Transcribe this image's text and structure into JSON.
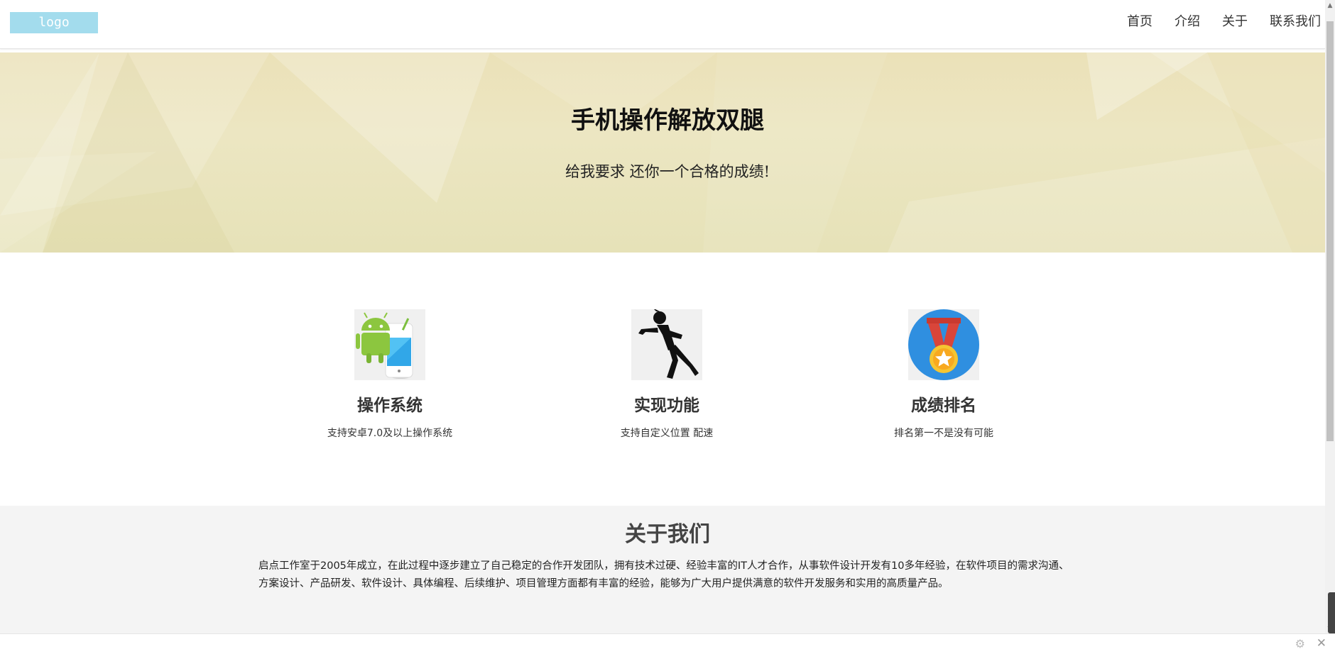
{
  "header": {
    "logo_text": "logo",
    "nav": [
      "首页",
      "介绍",
      "关于",
      "联系我们"
    ]
  },
  "hero": {
    "title": "手机操作解放双腿",
    "subtitle": "给我要求 还你一个合格的成绩!"
  },
  "features": [
    {
      "icon": "android-phone-icon",
      "title": "操作系统",
      "desc": "支持安卓7.0及以上操作系统"
    },
    {
      "icon": "running-man-icon",
      "title": "实现功能",
      "desc": "支持自定义位置 配速"
    },
    {
      "icon": "medal-icon",
      "title": "成绩排名",
      "desc": "排名第一不是没有可能"
    }
  ],
  "about": {
    "title": "关于我们",
    "text": "启点工作室于2005年成立，在此过程中逐步建立了自己稳定的合作开发团队，拥有技术过硬、经验丰富的IT人才合作，从事软件设计开发有10多年经验，在软件项目的需求沟通、方案设计、产品研发、软件设计、具体编程、后续维护、项目管理方面都有丰富的经验，能够为广大用户提供满意的软件开发服务和实用的高质量产品。"
  },
  "colors": {
    "logo_bg": "#a3dced",
    "hero_bg": "#ebe1b8",
    "about_bg": "#f4f4f4"
  }
}
